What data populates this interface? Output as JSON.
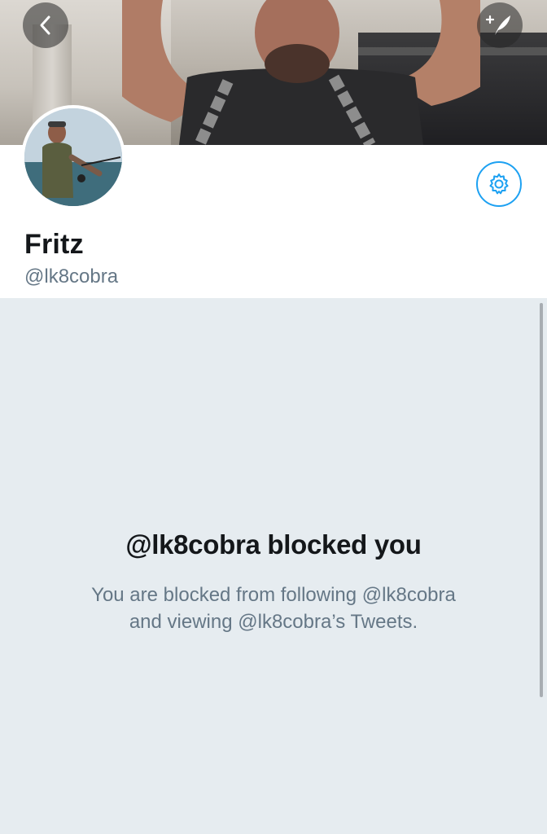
{
  "header": {
    "back_icon": "chevron-left-icon",
    "compose_icon": "compose-tweet-icon",
    "settings_icon": "gear-icon"
  },
  "profile": {
    "display_name": "Fritz",
    "handle": "@lk8cobra"
  },
  "blocked": {
    "title": "@lk8cobra blocked you",
    "line1": "You are blocked from following @lk8cobra",
    "line2": "and viewing @lk8cobra’s Tweets."
  },
  "colors": {
    "accent": "#1da1f2",
    "background": "#e6ecf0",
    "text_primary": "#14171a",
    "text_secondary": "#657786"
  }
}
